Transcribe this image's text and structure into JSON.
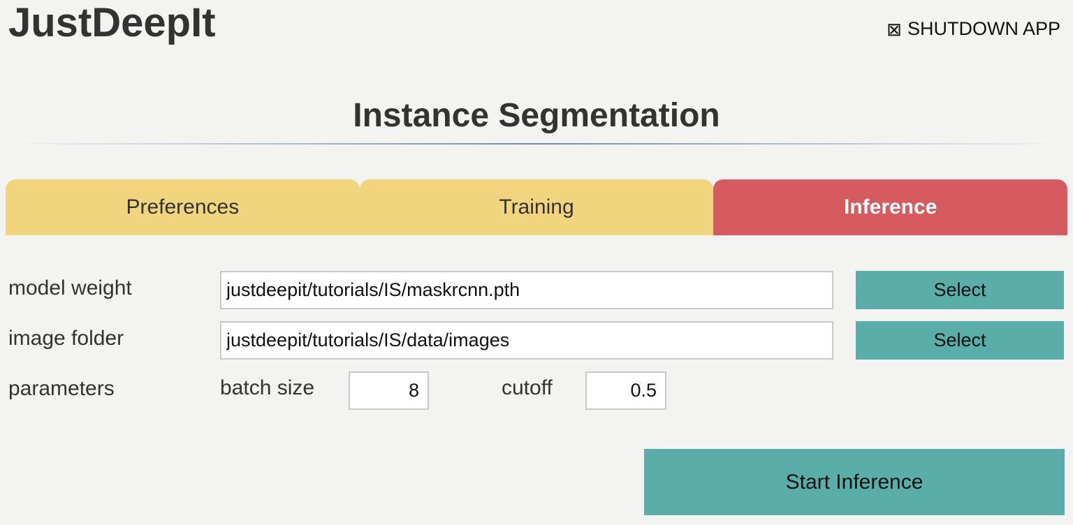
{
  "app": {
    "title": "JustDeepIt",
    "shutdown_icon": "checkbox-x-icon",
    "shutdown_glyph": "⊠",
    "shutdown_label": "SHUTDOWN APP"
  },
  "page": {
    "title": "Instance Segmentation"
  },
  "tabs": [
    {
      "label": "Preferences",
      "active": false
    },
    {
      "label": "Training",
      "active": false
    },
    {
      "label": "Inference",
      "active": true
    }
  ],
  "colors": {
    "background": "#f3f3f2",
    "tab_inactive": "#f1d57e",
    "tab_active": "#d65b60",
    "button": "#5aaea9"
  },
  "form": {
    "model_weight": {
      "label": "model weight",
      "value": "justdeepit/tutorials/IS/maskrcnn.pth",
      "button_label": "Select"
    },
    "image_folder": {
      "label": "image folder",
      "value": "justdeepit/tutorials/IS/data/images",
      "button_label": "Select"
    },
    "parameters": {
      "label": "parameters",
      "batch_size_label": "batch size",
      "batch_size_value": "8",
      "cutoff_label": "cutoff",
      "cutoff_value": "0.5"
    }
  },
  "actions": {
    "start_label": "Start Inference"
  }
}
